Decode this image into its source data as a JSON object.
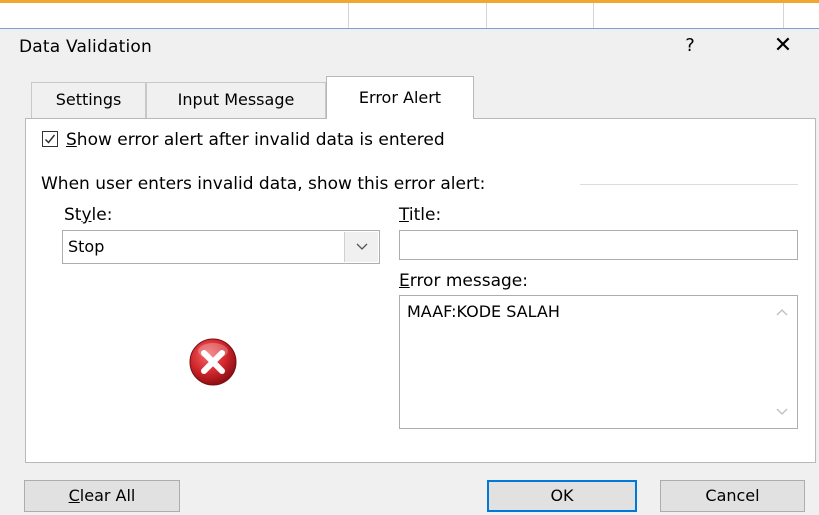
{
  "window": {
    "title": "Data Validation",
    "help_glyph": "?",
    "close_glyph": "✕"
  },
  "tabs": [
    {
      "label": "Settings",
      "active": false
    },
    {
      "label": "Input Message",
      "active": false
    },
    {
      "label": "Error Alert",
      "active": true
    }
  ],
  "error_alert": {
    "show_checkbox": {
      "checked": true,
      "mnemonic": "S",
      "label_rest": "how error alert after invalid data is entered"
    },
    "group_label": "When user enters invalid data, show this error alert:",
    "style": {
      "label_pre": "St",
      "mnemonic": "y",
      "label_post": "le:",
      "value": "Stop"
    },
    "title": {
      "mnemonic": "T",
      "label_rest": "itle:",
      "value": ""
    },
    "error_message": {
      "mnemonic": "E",
      "label_rest": "rror message:",
      "value": "MAAF:KODE SALAH"
    }
  },
  "buttons": {
    "clear_all": {
      "mnemonic": "C",
      "label_rest": "lear All"
    },
    "ok": "OK",
    "cancel": "Cancel"
  },
  "colors": {
    "accent": "#0078d7",
    "error_icon": "#c8262c",
    "sheet_accent": "#f0a830"
  }
}
